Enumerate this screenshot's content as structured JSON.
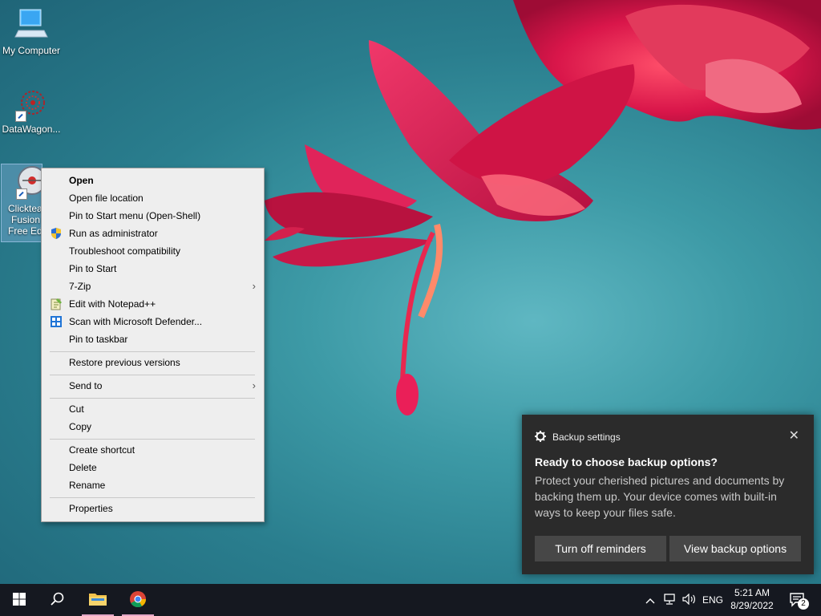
{
  "desktop": {
    "icons": [
      {
        "label": "My Computer"
      },
      {
        "label": "DataWagon..."
      },
      {
        "label_lines": [
          "Clickteam",
          "Fusion",
          "Free Edition"
        ]
      }
    ]
  },
  "context_menu": {
    "items": [
      {
        "label": "Open",
        "bold": true
      },
      {
        "label": "Open file location"
      },
      {
        "label": "Pin to Start menu (Open-Shell)"
      },
      {
        "label": "Run as administrator",
        "icon": "shield-icon"
      },
      {
        "label": "Troubleshoot compatibility"
      },
      {
        "label": "Pin to Start"
      },
      {
        "label": "7-Zip",
        "submenu": true
      },
      {
        "label": "Edit with Notepad++",
        "icon": "notepad-icon"
      },
      {
        "label": "Scan with Microsoft Defender...",
        "icon": "defender-icon"
      },
      {
        "label": "Pin to taskbar"
      },
      {
        "label": "Restore previous versions"
      },
      {
        "label": "Send to",
        "submenu": true
      },
      {
        "label": "Cut"
      },
      {
        "label": "Copy"
      },
      {
        "label": "Create shortcut"
      },
      {
        "label": "Delete"
      },
      {
        "label": "Rename"
      },
      {
        "label": "Properties"
      }
    ]
  },
  "toast": {
    "app_name": "Backup settings",
    "title": "Ready to choose backup options?",
    "body": "Protect your cherished pictures and documents by backing them up. Your device comes with built-in ways to keep your files safe.",
    "buttons": {
      "dismiss": "Turn off reminders",
      "action": "View backup options"
    },
    "close_glyph": "✕"
  },
  "taskbar": {
    "language": "ENG",
    "time": "5:21 AM",
    "date": "8/29/2022",
    "notification_count": "2"
  },
  "colors": {
    "toast_bg": "#2b2b2b",
    "taskbar_bg": "#151820",
    "menu_bg": "#eeeeee",
    "active_indicator": "#e2a6c5"
  }
}
